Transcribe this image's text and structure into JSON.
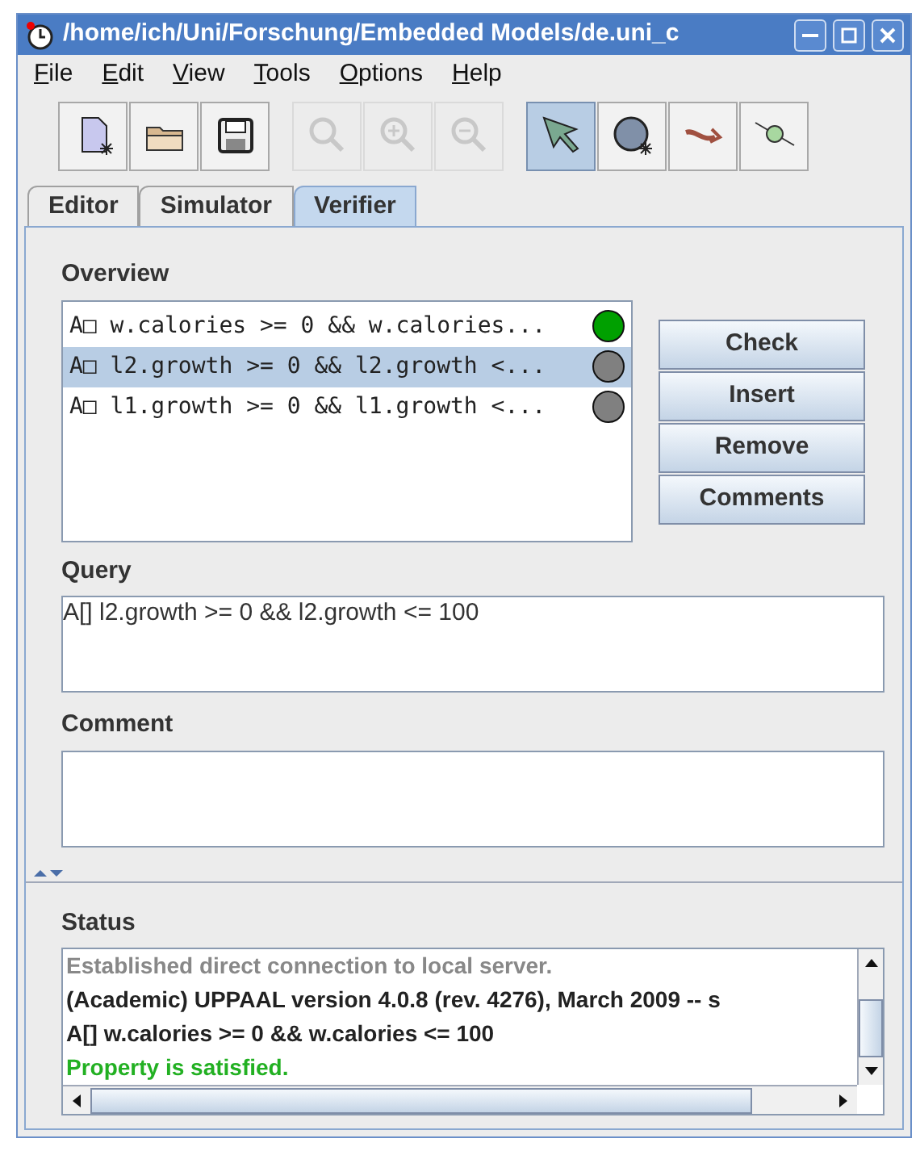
{
  "window": {
    "title": "/home/ich/Uni/Forschung/Embedded Models/de.uni_c"
  },
  "menu": [
    "File",
    "Edit",
    "View",
    "Tools",
    "Options",
    "Help"
  ],
  "toolbar": [
    {
      "kind": "new",
      "disabled": false,
      "selected": false
    },
    {
      "kind": "open",
      "disabled": false,
      "selected": false
    },
    {
      "kind": "save",
      "disabled": false,
      "selected": false
    },
    {
      "kind": "zoom",
      "disabled": true,
      "selected": false
    },
    {
      "kind": "zoom_in",
      "disabled": true,
      "selected": false
    },
    {
      "kind": "zoom_out",
      "disabled": true,
      "selected": false
    },
    {
      "kind": "select",
      "disabled": false,
      "selected": true
    },
    {
      "kind": "location",
      "disabled": false,
      "selected": false
    },
    {
      "kind": "edge",
      "disabled": false,
      "selected": false
    },
    {
      "kind": "nail",
      "disabled": false,
      "selected": false
    }
  ],
  "tabs": [
    {
      "label": "Editor",
      "selected": false
    },
    {
      "label": "Simulator",
      "selected": false
    },
    {
      "label": "Verifier",
      "selected": true
    }
  ],
  "overview": {
    "label": "Overview",
    "items": [
      {
        "text": "A□ w.calories >= 0 && w.calories...",
        "selected": false,
        "color": "#00a000"
      },
      {
        "text": "A□ l2.growth >= 0 && l2.growth <...",
        "selected": true,
        "color": "#808080"
      },
      {
        "text": "A□ l1.growth >= 0 && l1.growth <...",
        "selected": false,
        "color": "#808080"
      }
    ]
  },
  "buttons": [
    "Check",
    "Insert",
    "Remove",
    "Comments"
  ],
  "query": {
    "label": "Query",
    "value": "A[] l2.growth >= 0 && l2.growth <= 100"
  },
  "comment": {
    "label": "Comment"
  },
  "status": {
    "label": "Status",
    "lines": [
      {
        "kind": "info",
        "text": "Established direct connection to local server."
      },
      {
        "kind": "plain",
        "text": "(Academic) UPPAAL version 4.0.8 (rev. 4276), March 2009 -- s"
      },
      {
        "kind": "plain",
        "text": "A[] w.calories >= 0 && w.calories <= 100"
      },
      {
        "kind": "success",
        "text": "Property is satisfied."
      }
    ]
  }
}
